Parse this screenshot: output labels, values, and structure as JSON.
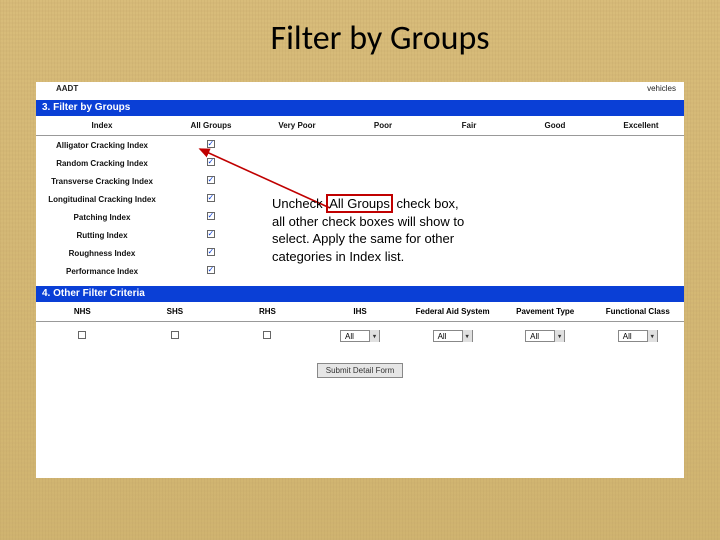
{
  "title": "Filter by Groups",
  "top_cut": {
    "label": "AADT",
    "right_label": "vehicles"
  },
  "section3": {
    "bar": "3. Filter by Groups",
    "headers": [
      "Index",
      "All Groups",
      "Very Poor",
      "Poor",
      "Fair",
      "Good",
      "Excellent"
    ],
    "rows": [
      "Alligator Cracking Index",
      "Random Cracking Index",
      "Transverse Cracking Index",
      "Longitudinal Cracking Index",
      "Patching Index",
      "Rutting Index",
      "Roughness Index",
      "Performance Index"
    ]
  },
  "section4": {
    "bar": "4. Other Filter Criteria",
    "headers": [
      "NHS",
      "SHS",
      "RHS",
      "IHS",
      "Federal Aid System",
      "Pavement Type",
      "Functional Class"
    ],
    "select_default": "All"
  },
  "submit_label": "Submit Detail Form",
  "callout": {
    "pre": "Uncheck ",
    "boxed": "All Groups",
    "post1": " check box,",
    "line2": "all other check boxes will show to",
    "line3": "select. Apply the same for other",
    "line4": "categories in Index list."
  }
}
